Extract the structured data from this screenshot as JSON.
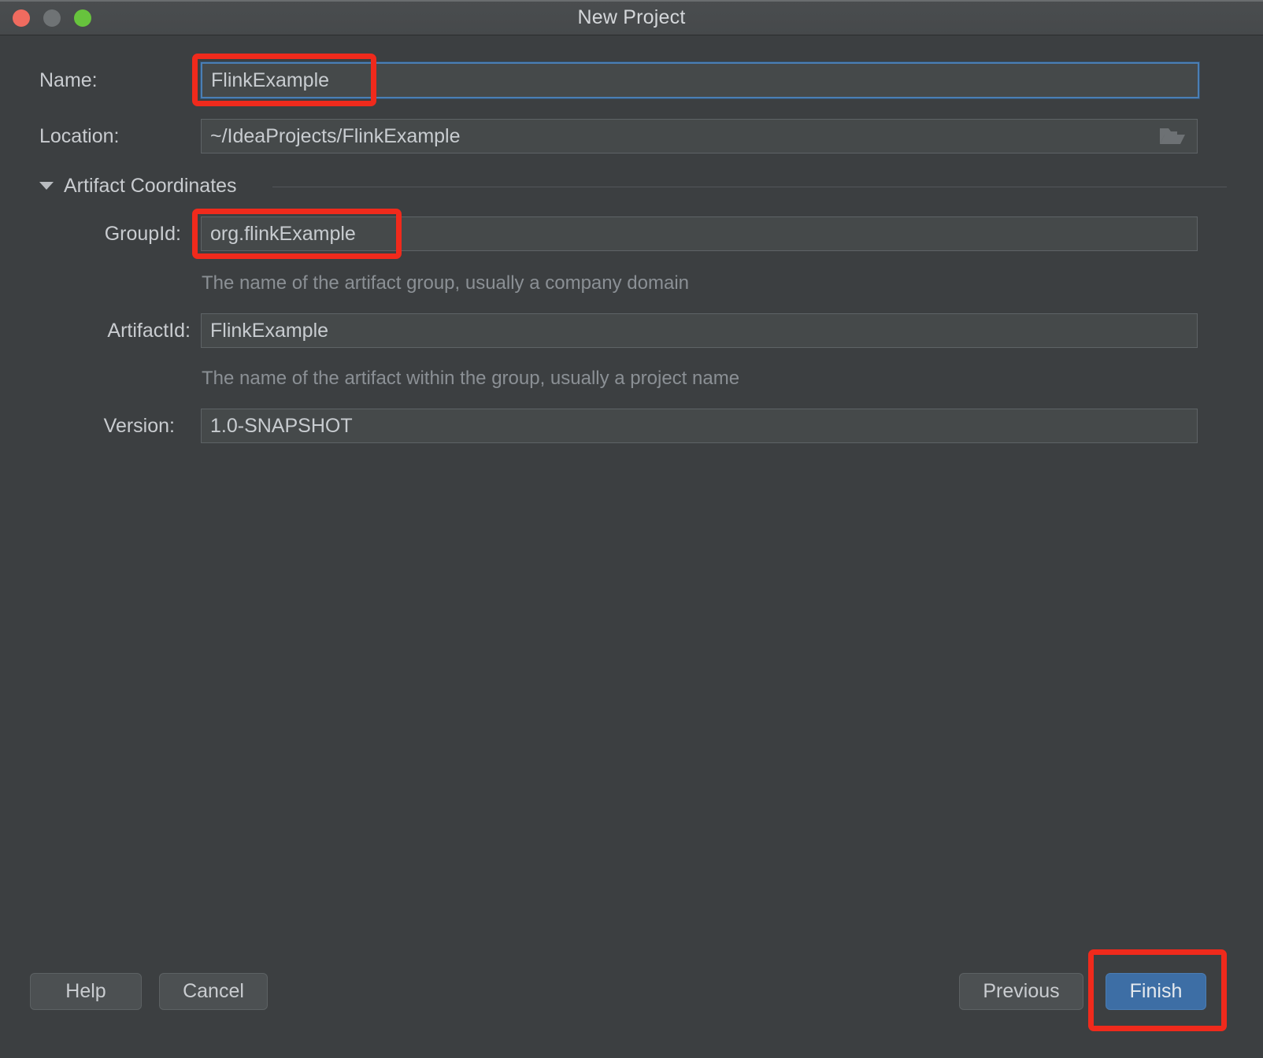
{
  "window": {
    "title": "New Project",
    "controls": {
      "close": "close-button",
      "minimize": "minimize-button",
      "zoom": "zoom-button"
    }
  },
  "form": {
    "name": {
      "label": "Name:",
      "value": "FlinkExample",
      "focused": true
    },
    "location": {
      "label": "Location:",
      "value": "~/IdeaProjects/FlinkExample",
      "browse_icon": "folder-icon"
    },
    "artifact_section": {
      "title": "Artifact Coordinates",
      "expanded": true,
      "toggle_icon": "chevron-down-icon"
    },
    "group_id": {
      "label": "GroupId:",
      "value": "org.flinkExample",
      "hint": "The name of the artifact group, usually a company domain"
    },
    "artifact_id": {
      "label": "ArtifactId:",
      "value": "FlinkExample",
      "hint": "The name of the artifact within the group, usually a project name"
    },
    "version": {
      "label": "Version:",
      "value": "1.0-SNAPSHOT"
    }
  },
  "footer": {
    "help": "Help",
    "cancel": "Cancel",
    "previous": "Previous",
    "finish": "Finish"
  },
  "colors": {
    "dialog_bg": "#3c3f41",
    "titlebar_bg": "#474a4c",
    "field_bg": "#45494a",
    "field_border": "#5e6366",
    "focus_blue": "#4a7fb5",
    "primary_button": "#3d6ea5",
    "text": "#c9ccd0",
    "hint_text": "#8b9095",
    "annotation_red": "#f02a1c",
    "traffic_close": "#ef6b5f",
    "traffic_minimize": "#6f7375",
    "traffic_zoom": "#67c33d"
  },
  "annotations": [
    {
      "target": "name-input",
      "shape": "rounded-rect"
    },
    {
      "target": "group-id-input",
      "shape": "rounded-rect"
    },
    {
      "target": "finish-button",
      "shape": "rounded-rect"
    }
  ]
}
